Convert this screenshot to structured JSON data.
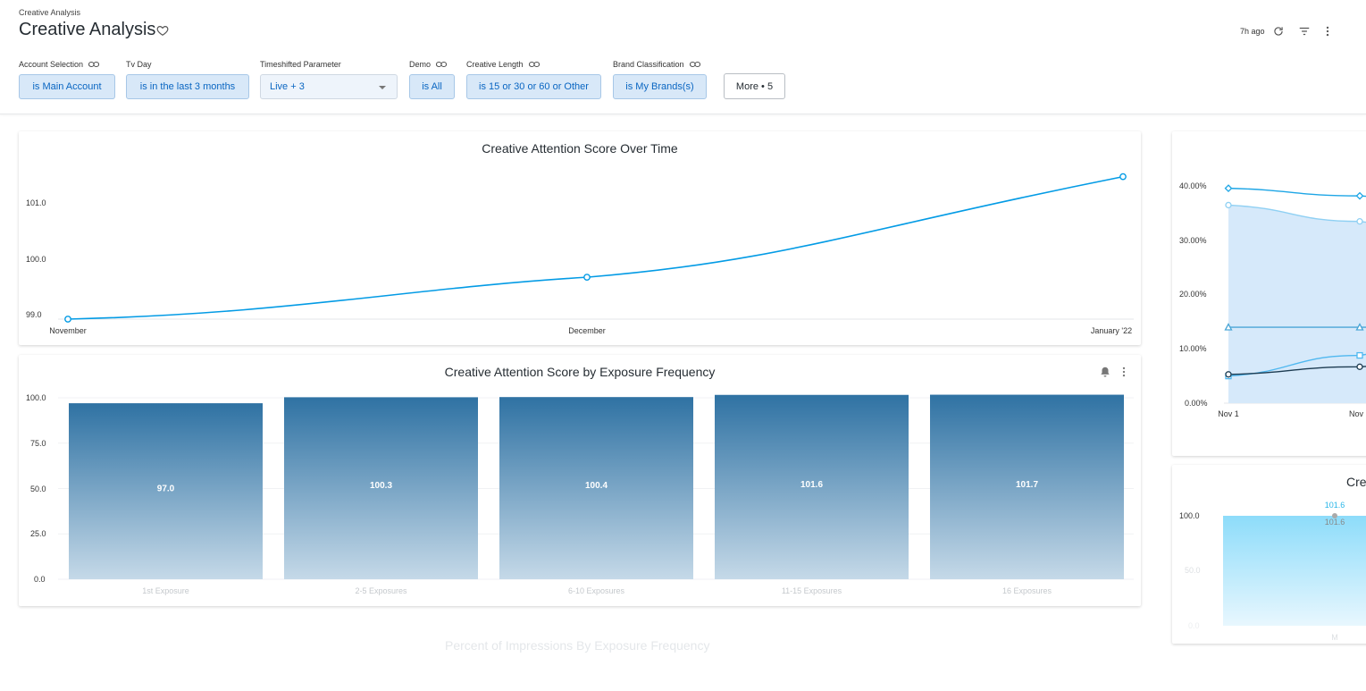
{
  "header": {
    "breadcrumb": "Creative Analysis",
    "title": "Creative Analysis",
    "updated": "7h ago",
    "icons": [
      "heart-icon",
      "refresh-icon",
      "filter-icon",
      "more-vertical-icon"
    ]
  },
  "filters": [
    {
      "label": "Account Selection",
      "value": "is Main Account",
      "linked": true
    },
    {
      "label": "Tv Day",
      "value": "is in the last 3 months",
      "linked": false
    },
    {
      "label": "Timeshifted Parameter",
      "value": "Live + 3",
      "linked": false
    },
    {
      "label": "Demo",
      "value": "is All",
      "linked": true
    },
    {
      "label": "Creative Length",
      "value": "is 15 or 30 or 60 or Other",
      "linked": true
    },
    {
      "label": "Brand Classification",
      "value": "is My Brands(s)",
      "linked": true
    }
  ],
  "more_button": "More • 5",
  "colors": {
    "accent": "#0a66c2",
    "chip_bg": "#d8e8f8",
    "line": "#039be5",
    "bar_top": "#2f72a3",
    "bar_bottom": "#c5d9e8"
  },
  "chart1": {
    "title": "Creative Attention Score Over Time",
    "chart_data": {
      "type": "line",
      "categories": [
        "November",
        "December",
        "January '22"
      ],
      "series": [
        {
          "values": [
            99.0,
            99.75,
            101.55
          ]
        }
      ],
      "yticks": [
        "99.0",
        "100.0",
        "101.0"
      ],
      "ylim": [
        99.0,
        102.0
      ],
      "grid": false
    }
  },
  "chart2": {
    "title": "Creative Attention Score by Exposure Frequency",
    "icons": [
      "alert-bell-icon",
      "more-vertical-icon"
    ],
    "chart_data": {
      "type": "bar",
      "categories": [
        "1st Exposure",
        "2-5 Exposures",
        "6-10 Exposures",
        "11-15 Exposures",
        "16 Exposures"
      ],
      "values": [
        97.0,
        100.3,
        100.4,
        101.6,
        101.7
      ],
      "value_labels": [
        "97.0",
        "100.3",
        "100.4",
        "101.6",
        "101.7"
      ],
      "yticks": [
        "0.0",
        "25.0",
        "50.0",
        "75.0",
        "100.0"
      ],
      "ylim": [
        0,
        100
      ],
      "grid": true
    }
  },
  "chart3": {
    "chart_data": {
      "type": "line",
      "categories": [
        "Nov 1",
        "Nov"
      ],
      "series": [
        {
          "marker": "diamond",
          "values": [
            39.6,
            38.2
          ]
        },
        {
          "marker": "circle",
          "area": true,
          "values": [
            36.5,
            33.5
          ]
        },
        {
          "marker": "triangle",
          "values": [
            14.0,
            14.0
          ]
        },
        {
          "marker": "square",
          "values": [
            5.0,
            8.8
          ]
        },
        {
          "marker": "circle-dark",
          "values": [
            5.3,
            6.7
          ]
        }
      ],
      "yticks": [
        "0.00%",
        "10.00%",
        "20.00%",
        "30.00%",
        "40.00%"
      ],
      "ylim": [
        0,
        40
      ]
    }
  },
  "chart4": {
    "title": "Cre",
    "chart_data": {
      "type": "bar",
      "categories": [
        "M"
      ],
      "values": [
        101.6
      ],
      "value_labels": [
        "101.6",
        "101.6"
      ],
      "yticks": [
        "0.0",
        "50.0",
        "100.0"
      ],
      "ylim": [
        0,
        100
      ]
    }
  },
  "faded_title": "Percent of Impressions By Exposure Frequency"
}
